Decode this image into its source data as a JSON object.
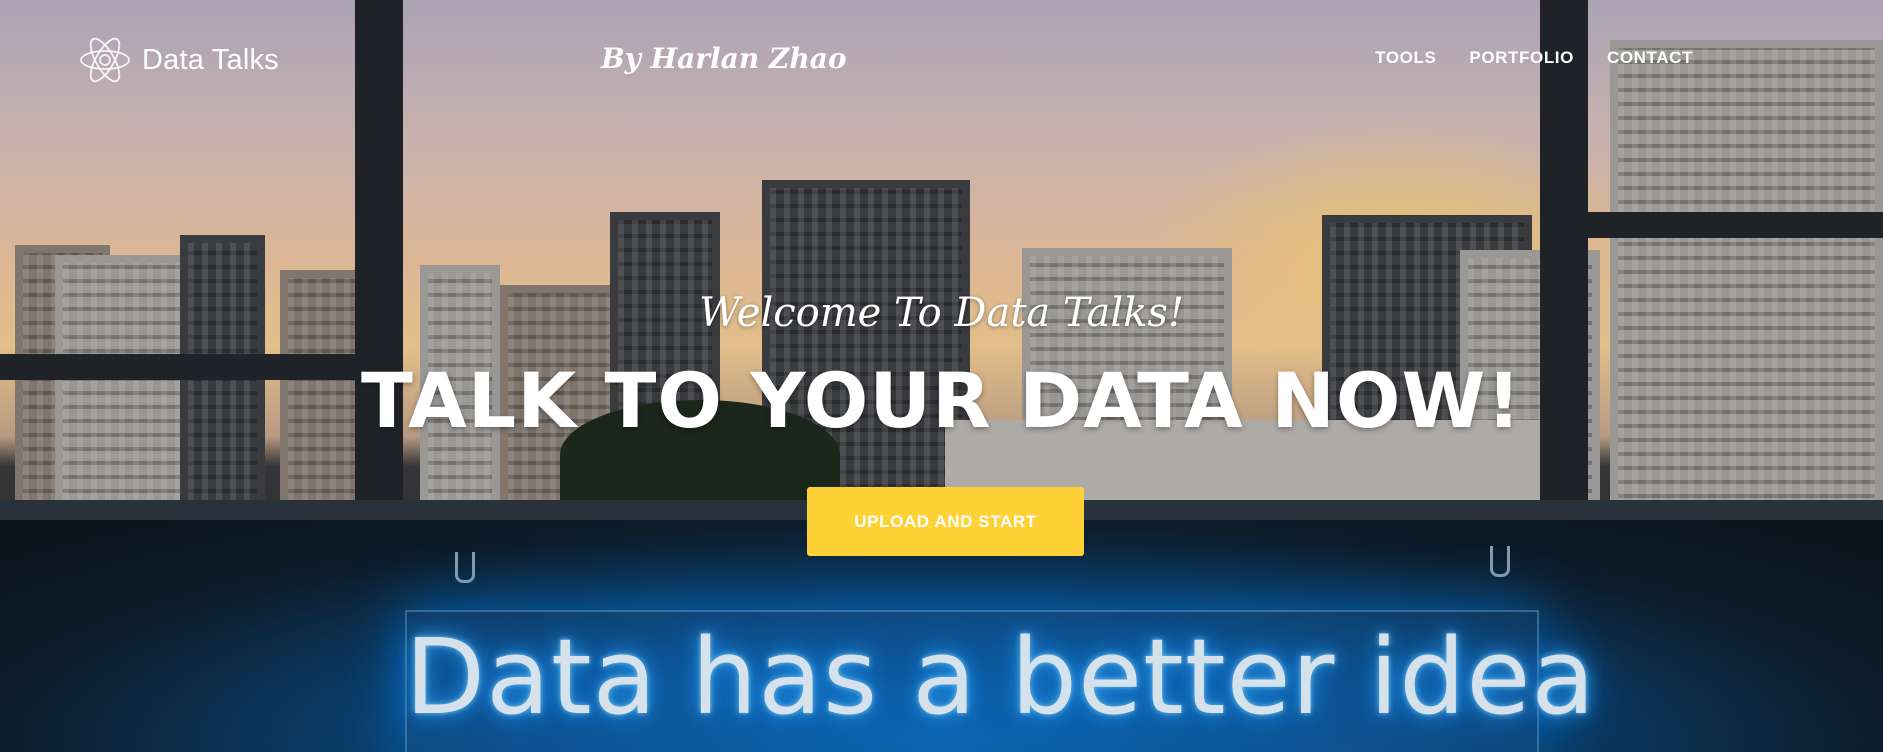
{
  "brand": {
    "name": "Data Talks",
    "icon": "atom-icon"
  },
  "author": "By Harlan Zhao",
  "nav": {
    "items": [
      {
        "label": "TOOLS"
      },
      {
        "label": "PORTFOLIO"
      },
      {
        "label": "CONTACT"
      }
    ]
  },
  "masthead": {
    "subheading": "Welcome To Data Talks!",
    "heading": "TALK TO YOUR DATA NOW!",
    "cta_label": "UPLOAD AND START"
  },
  "background": {
    "neon_sign": "Data has a better idea"
  },
  "colors": {
    "accent": "#fed136",
    "text": "#ffffff",
    "neon": "#2aa8ff"
  }
}
